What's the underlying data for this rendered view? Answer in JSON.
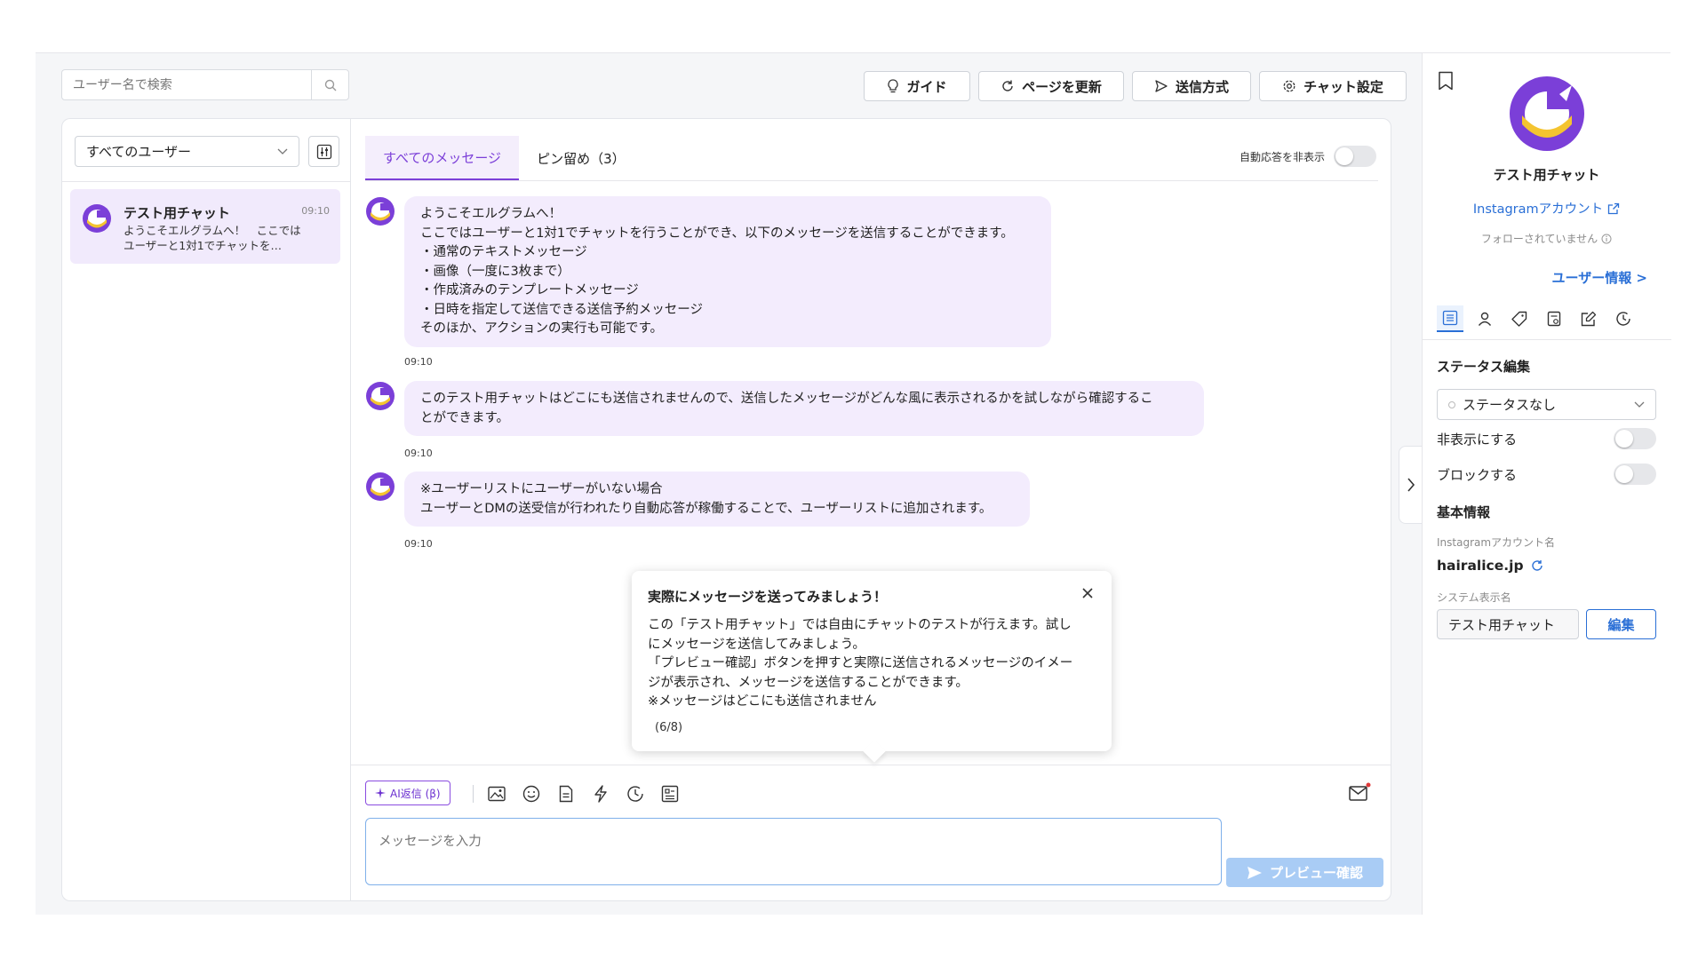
{
  "search": {
    "placeholder": "ユーザー名で検索"
  },
  "toolbar": {
    "guide_label": "ガイド",
    "refresh_label": "ページを更新",
    "send_method_label": "送信方式",
    "chat_settings_label": "チャット設定"
  },
  "user_list": {
    "filter_value": "すべてのユーザー",
    "items": [
      {
        "name": "テスト用チャット",
        "time": "09:10",
        "preview": "ようこそエルグラムへ！　ここではユーザーと1対1でチャットを…"
      }
    ]
  },
  "chat": {
    "tabs": [
      {
        "label": "すべてのメッセージ"
      },
      {
        "label": "ピン留め（3）"
      }
    ],
    "auto_reply_toggle_label": "自動応答を非表示",
    "messages": [
      {
        "text": "ようこそエルグラムへ！\nここではユーザーと1対1でチャットを行うことができ、以下のメッセージを送信することができます。\n・通常のテキストメッセージ\n・画像（一度に3枚まで）\n・作成済みのテンプレートメッセージ\n・日時を指定して送信できる送信予約メッセージ\nそのほか、アクションの実行も可能です。",
        "time": "09:10"
      },
      {
        "text": "このテスト用チャットはどこにも送信されませんので、送信したメッセージがどんな風に表示されるかを試しながら確認するこ\nとができます。",
        "time": "09:10"
      },
      {
        "text": "※ユーザーリストにユーザーがいない場合\nユーザーとDMの送受信が行われたり自動応答が稼働することで、ユーザーリストに追加されます。",
        "time": "09:10"
      }
    ],
    "tooltip": {
      "title": "実際にメッセージを送ってみましょう！",
      "body": "この「テスト用チャット」では自由にチャットのテストが行えます。試し\nにメッセージを送信してみましょう。\n「プレビュー確認」ボタンを押すと実際に送信されるメッセージのイメー\nジが表示され、メッセージを送信することができます。\n※メッセージはどこにも送信されません",
      "step": "(6/8)"
    },
    "composer": {
      "ai_button_label": "AI返信 (β)",
      "input_placeholder": "メッセージを入力",
      "preview_button_label": "プレビュー確認"
    }
  },
  "profile": {
    "name": "テスト用チャット",
    "instagram_link": "Instagramアカウント",
    "follow_status": "フォローされていません",
    "user_info_link": "ユーザー情報 >",
    "status_section_title": "ステータス編集",
    "status_value": "ステータスなし",
    "hide_label": "非表示にする",
    "block_label": "ブロックする",
    "basic_info_title": "基本情報",
    "ig_account_label": "Instagramアカウント名",
    "ig_account_value": "hairalice.jp",
    "system_name_label": "システム表示名",
    "system_name_value": "テスト用チャット",
    "edit_button_label": "編集"
  },
  "colors": {
    "accent_purple": "#7b3fd8",
    "bubble": "#f3ecfd",
    "link_blue": "#2a6fd6",
    "preview_button": "#a9ccf5"
  }
}
